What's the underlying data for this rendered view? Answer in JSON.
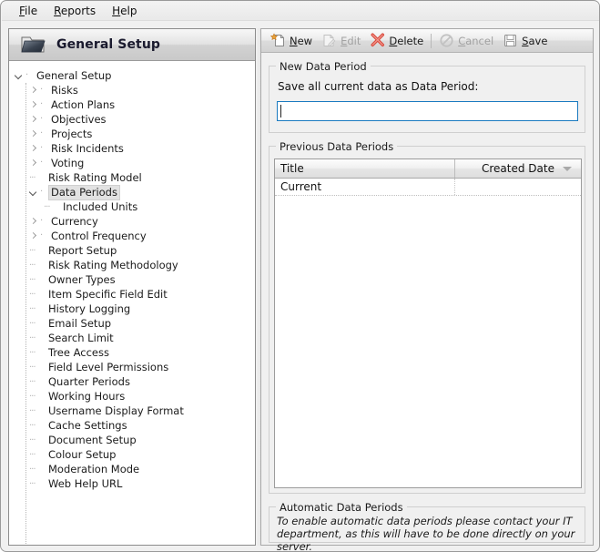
{
  "window": {
    "menu": [
      {
        "label": "File",
        "accel": "F"
      },
      {
        "label": "Reports",
        "accel": "R"
      },
      {
        "label": "Help",
        "accel": "H"
      }
    ]
  },
  "left_panel": {
    "icon": "folder-icon",
    "title": "General Setup",
    "tree": [
      {
        "label": "General Setup",
        "depth": 0,
        "marker": "chevron-down",
        "selected": false
      },
      {
        "label": "Risks",
        "depth": 1,
        "marker": "chevron-right",
        "selected": false
      },
      {
        "label": "Action Plans",
        "depth": 1,
        "marker": "chevron-right",
        "selected": false
      },
      {
        "label": "Objectives",
        "depth": 1,
        "marker": "chevron-right",
        "selected": false
      },
      {
        "label": "Projects",
        "depth": 1,
        "marker": "chevron-right",
        "selected": false
      },
      {
        "label": "Risk Incidents",
        "depth": 1,
        "marker": "chevron-right",
        "selected": false
      },
      {
        "label": "Voting",
        "depth": 1,
        "marker": "chevron-right",
        "selected": false
      },
      {
        "label": "Risk Rating Model",
        "depth": 1,
        "marker": "leaf",
        "selected": false
      },
      {
        "label": "Data Periods",
        "depth": 1,
        "marker": "chevron-down",
        "selected": true
      },
      {
        "label": "Included Units",
        "depth": 2,
        "marker": "leaf",
        "selected": false
      },
      {
        "label": "Currency",
        "depth": 1,
        "marker": "chevron-right",
        "selected": false
      },
      {
        "label": "Control Frequency",
        "depth": 1,
        "marker": "chevron-right",
        "selected": false
      },
      {
        "label": "Report Setup",
        "depth": 1,
        "marker": "leaf",
        "selected": false
      },
      {
        "label": "Risk Rating Methodology",
        "depth": 1,
        "marker": "leaf",
        "selected": false
      },
      {
        "label": "Owner Types",
        "depth": 1,
        "marker": "leaf",
        "selected": false
      },
      {
        "label": "Item Specific Field Edit",
        "depth": 1,
        "marker": "leaf",
        "selected": false
      },
      {
        "label": "History Logging",
        "depth": 1,
        "marker": "leaf",
        "selected": false
      },
      {
        "label": "Email Setup",
        "depth": 1,
        "marker": "leaf",
        "selected": false
      },
      {
        "label": "Search Limit",
        "depth": 1,
        "marker": "leaf",
        "selected": false
      },
      {
        "label": "Tree Access",
        "depth": 1,
        "marker": "leaf",
        "selected": false
      },
      {
        "label": "Field Level Permissions",
        "depth": 1,
        "marker": "leaf",
        "selected": false
      },
      {
        "label": "Quarter Periods",
        "depth": 1,
        "marker": "leaf",
        "selected": false
      },
      {
        "label": "Working Hours",
        "depth": 1,
        "marker": "leaf",
        "selected": false
      },
      {
        "label": "Username Display Format",
        "depth": 1,
        "marker": "leaf",
        "selected": false
      },
      {
        "label": "Cache Settings",
        "depth": 1,
        "marker": "leaf",
        "selected": false
      },
      {
        "label": "Document Setup",
        "depth": 1,
        "marker": "leaf",
        "selected": false
      },
      {
        "label": "Colour Setup",
        "depth": 1,
        "marker": "leaf",
        "selected": false
      },
      {
        "label": "Moderation Mode",
        "depth": 1,
        "marker": "leaf",
        "selected": false
      },
      {
        "label": "Web Help URL",
        "depth": 1,
        "marker": "leaf",
        "selected": false
      }
    ]
  },
  "toolbar": {
    "buttons": [
      {
        "label": "New",
        "accel": "N",
        "icon": "new-page-icon",
        "enabled": true
      },
      {
        "label": "Edit",
        "accel": "E",
        "icon": "edit-pencil-icon",
        "enabled": false
      },
      {
        "label": "Delete",
        "accel": "D",
        "icon": "delete-x-icon",
        "enabled": true
      },
      {
        "label": "Cancel",
        "accel": "C",
        "icon": "cancel-circle-icon",
        "enabled": false
      },
      {
        "label": "Save",
        "accel": "S",
        "icon": "save-disk-icon",
        "enabled": true
      }
    ]
  },
  "new_data_period": {
    "legend": "New Data Period",
    "field_label": "Save all current data as Data Period:",
    "input_value": "",
    "input_placeholder": "",
    "focused": true
  },
  "previous_data_periods": {
    "legend": "Previous Data Periods",
    "columns": [
      "Title",
      "Created Date"
    ],
    "sort_indicator_column": "Created Date",
    "rows": [
      {
        "title": "Current",
        "created_date": ""
      }
    ]
  },
  "automatic_data_periods": {
    "legend": "Automatic Data Periods",
    "text": "To enable automatic data periods please contact your IT department, as this will have to be done directly on your server."
  },
  "colors": {
    "focus_border": "#1a7ac0",
    "delete_icon": "#cc3333",
    "new_icon_star": "#e8a33d",
    "window_bg": "#f0f0f0"
  }
}
